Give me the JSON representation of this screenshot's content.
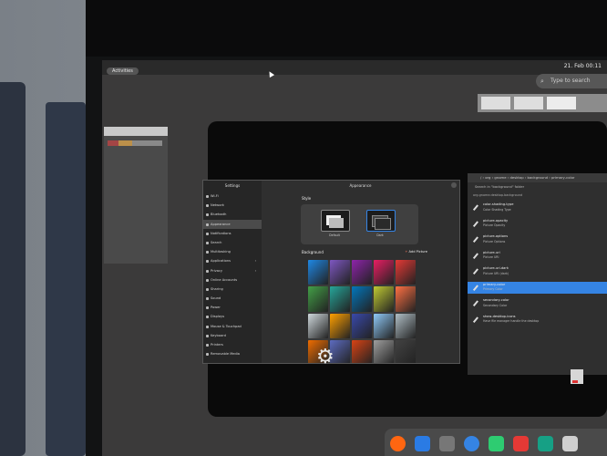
{
  "topbar": {
    "activities_label": "Activities",
    "clock": "21. Feb 00:11"
  },
  "search": {
    "placeholder": "Type to search"
  },
  "settings": {
    "sidebar_title": "Settings",
    "main_title": "Appearance",
    "sidebar_items": [
      {
        "label": "Wi-Fi",
        "chevron": false
      },
      {
        "label": "Network",
        "chevron": false
      },
      {
        "label": "Bluetooth",
        "chevron": false
      },
      {
        "label": "Appearance",
        "chevron": false,
        "active": true
      },
      {
        "label": "Notifications",
        "chevron": false
      },
      {
        "label": "Search",
        "chevron": false
      },
      {
        "label": "Multitasking",
        "chevron": false
      },
      {
        "label": "Applications",
        "chevron": true
      },
      {
        "label": "Privacy",
        "chevron": true
      },
      {
        "label": "Online Accounts",
        "chevron": false
      },
      {
        "label": "Sharing",
        "chevron": false
      },
      {
        "label": "Sound",
        "chevron": false
      },
      {
        "label": "Power",
        "chevron": false
      },
      {
        "label": "Displays",
        "chevron": false
      },
      {
        "label": "Mouse & Touchpad",
        "chevron": false
      },
      {
        "label": "Keyboard",
        "chevron": false
      },
      {
        "label": "Printers",
        "chevron": false
      },
      {
        "label": "Removable Media",
        "chevron": false
      }
    ],
    "style_heading": "Style",
    "style_default": "Default",
    "style_dark": "Dark",
    "background_heading": "Background",
    "add_picture_label": "Add Picture",
    "wallpapers": [
      "#1e88e5",
      "#7e57c2",
      "#8e24aa",
      "#e91e63",
      "#e53935",
      "#43a047",
      "#26a69a",
      "#0277bd",
      "#c0ca33",
      "#ff7043",
      "#cfd8dc",
      "#ffa000",
      "#3949ab",
      "#90caf9",
      "#b0bec5",
      "#ef6c00",
      "#5c6bc0",
      "#d84315",
      "#9e9e9e",
      "#424242"
    ]
  },
  "editor": {
    "path": "/ › org › gnome › desktop › background › primary-color",
    "search_hint": "Search in \"background\" folder",
    "section": "org.gnome.desktop.background",
    "rows": [
      {
        "key": "color-shading-type",
        "summary": "Color Shading Type",
        "selected": false
      },
      {
        "key": "picture-opacity",
        "summary": "Picture Opacity",
        "selected": false
      },
      {
        "key": "picture-options",
        "summary": "Picture Options",
        "selected": false
      },
      {
        "key": "picture-uri",
        "summary": "Picture URI",
        "selected": false
      },
      {
        "key": "picture-uri-dark",
        "summary": "Picture URI (dark)",
        "selected": false
      },
      {
        "key": "primary-color",
        "summary": "Primary Color",
        "selected": true
      },
      {
        "key": "secondary-color",
        "summary": "Secondary Color",
        "selected": false
      },
      {
        "key": "show-desktop-icons",
        "summary": "Have file manager handle the desktop",
        "selected": false
      }
    ]
  },
  "dock": {
    "apps": [
      "firefox-icon",
      "phone-icon",
      "grid-icon",
      "circle-app-icon",
      "green-app-icon",
      "red-app-icon",
      "teal-app-icon",
      "doc-icon"
    ],
    "colors": [
      "#ff6611",
      "#2a7be4",
      "#777777",
      "#3584e4",
      "#2ecc71",
      "#e53935",
      "#16a085",
      "#cfcfcf"
    ]
  }
}
